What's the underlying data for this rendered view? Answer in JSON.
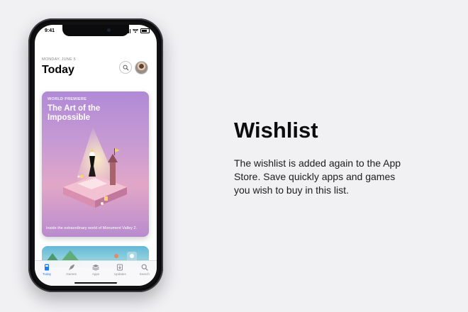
{
  "phone": {
    "status_time": "9:41",
    "date": "MONDAY, JUNE 5",
    "title": "Today",
    "featured_card": {
      "eyebrow": "WORLD PREMIERE",
      "title": "The Art of the Impossible",
      "caption": "Inside the extraordinary world of Monument Valley 2."
    },
    "tabs": [
      {
        "label": "Today",
        "icon": "today-icon",
        "active": true
      },
      {
        "label": "Games",
        "icon": "rocket-icon",
        "active": false
      },
      {
        "label": "Apps",
        "icon": "stack-icon",
        "active": false
      },
      {
        "label": "Updates",
        "icon": "download-icon",
        "active": false
      },
      {
        "label": "Search",
        "icon": "search-icon",
        "active": false
      }
    ],
    "accent_color": "#1a7df5"
  },
  "feature": {
    "title": "Wishlist",
    "description": "The wishlist is added again to the App Store. Save quickly apps and games you wish to buy in this list."
  }
}
